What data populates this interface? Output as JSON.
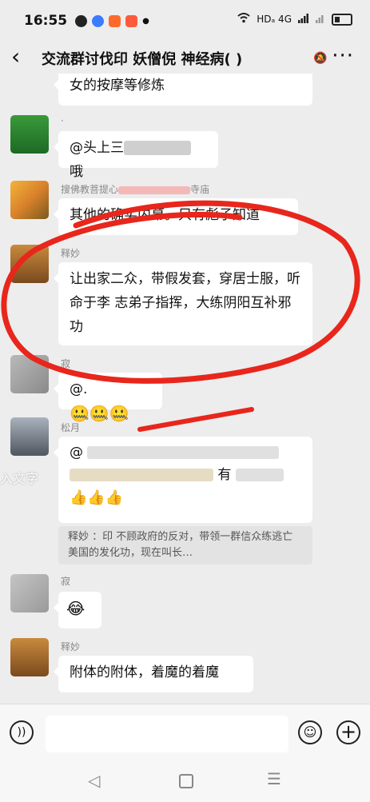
{
  "status": {
    "time": "16:55",
    "network": "HDₐ 4G",
    "app_icons": [
      "#222222",
      "#3b7cff",
      "#ff6a2b",
      "#ff5a3c"
    ]
  },
  "header": {
    "back_icon": "back-chevron-icon",
    "title": "交流群讨伐印 妖僧倪 神经病( )",
    "mute_icon": "bell-off-icon"
  },
  "messages": {
    "m0": {
      "text": "女的按摩等修炼"
    },
    "m1": {
      "sender": "·",
      "text_prefix": "@头上三",
      "text_suffix": "哦"
    },
    "m2": {
      "sender_prefix": "搜佛教菩提心",
      "sender_suffix": "寺庙",
      "text": "其他的确实内幕。只有彪子知道"
    },
    "m3": {
      "sender": "释妙",
      "text": "让出家二众，带假发套，穿居士服，听命于李  志弟子指挥，大练阴阳互补邪功"
    },
    "m4": {
      "sender": "寂",
      "text": "@."
    },
    "m5": {
      "sender": "松月",
      "text_line1": "@",
      "text_line2": "有"
    },
    "m5_quote": {
      "text": "释妙 ：印 不顾政府的反对，带领一群信众练逃亡美国的发化功，现在叫长"
    },
    "m6": {
      "sender": "寂"
    },
    "m7": {
      "sender": "释妙",
      "text": "附体的附体，着魔的着魔"
    }
  },
  "overlay": {
    "side_text": "入文字",
    "annotation_color": "#e8261c"
  },
  "input": {
    "placeholder": ""
  }
}
